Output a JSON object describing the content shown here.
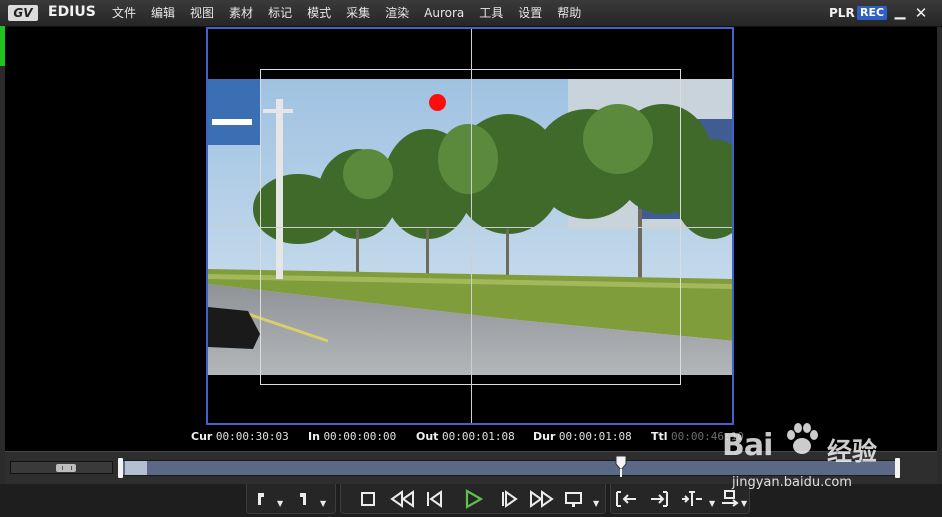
{
  "app": {
    "logo_text": "GV",
    "name": "EDIUS",
    "mode_plr": "PLR",
    "mode_rec": "REC",
    "minimize_glyph": "▁",
    "close_glyph": "✕"
  },
  "menu": [
    "文件",
    "编辑",
    "视图",
    "素材",
    "标记",
    "模式",
    "采集",
    "渲染",
    "Aurora",
    "工具",
    "设置",
    "帮助"
  ],
  "timecodes": {
    "cur": {
      "label": "Cur",
      "value": "00:00:30:03"
    },
    "in": {
      "label": "In",
      "value": "00:00:00:00"
    },
    "out": {
      "label": "Out",
      "value": "00:00:01:08"
    },
    "dur": {
      "label": "Dur",
      "value": "00:00:01:08"
    },
    "ttl": {
      "label": "Ttl",
      "value": "00:00:46:10"
    }
  },
  "playback": {
    "position_fraction": 0.645,
    "active_button": "play"
  },
  "colors": {
    "accent_blue": "#4561c9",
    "rec_badge": "#2d5fc4",
    "play_green": "#5cc24a",
    "record_dot": "#ff0d0d",
    "scrub_track": "#5a6986"
  },
  "icons": [
    "set-in-point-icon",
    "set-out-point-icon",
    "stop-icon",
    "rewind-icon",
    "step-back-icon",
    "play-icon",
    "step-forward-icon",
    "fast-forward-icon",
    "output-monitor-icon",
    "insert-to-timeline-icon",
    "overwrite-to-timeline-icon",
    "split-edit-icon",
    "extend-icon"
  ],
  "watermark": {
    "logo": "Bai",
    "text": "经验",
    "url": "jingyan.baidu.com"
  }
}
